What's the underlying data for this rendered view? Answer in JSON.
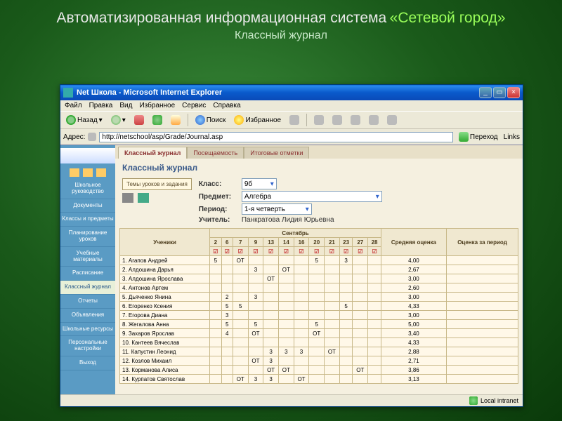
{
  "slide": {
    "title_plain": "Автоматизированная информационная система",
    "title_accent": "«Сетевой город»",
    "subtitle": "Классный журнал"
  },
  "window": {
    "title": "Net Школа - Microsoft Internet Explorer",
    "menus": [
      "Файл",
      "Правка",
      "Вид",
      "Избранное",
      "Сервис",
      "Справка"
    ],
    "toolbar": {
      "back": "Назад",
      "search": "Поиск",
      "favorites": "Избранное"
    },
    "address_label": "Адрес:",
    "address": "http://netschool/asp/Grade/Journal.asp",
    "go": "Переход",
    "links": "Links",
    "status": "Local intranet"
  },
  "sidebar": {
    "items": [
      "Школьное руководство",
      "Документы",
      "Классы и предметы",
      "Планирование уроков",
      "Учебные материалы",
      "Расписание",
      "Классный журнал",
      "Отчеты",
      "Объявления",
      "Школьные ресурсы",
      "Персональные настройки",
      "Выход"
    ]
  },
  "tabs": [
    "Классный журнал",
    "Посещаемость",
    "Итоговые отметки"
  ],
  "heading": "Классный журнал",
  "lesson_btn": "Темы уроков и задания",
  "filters": {
    "class_label": "Класс:",
    "class_value": "9б",
    "subject_label": "Предмет:",
    "subject_value": "Алгебра",
    "period_label": "Период:",
    "period_value": "1-я четверть",
    "teacher_label": "Учитель:",
    "teacher_value": "Панкратова Лидия Юрьевна"
  },
  "table": {
    "students_header": "Ученики",
    "month": "Сентябрь",
    "avg_header": "Средняя оценка",
    "period_header": "Оценка за период",
    "days": [
      "2",
      "6",
      "7",
      "9",
      "13",
      "14",
      "16",
      "20",
      "21",
      "23",
      "27",
      "28"
    ],
    "rows": [
      {
        "n": "1",
        "name": "Агапов Андрей",
        "cells": [
          "5",
          "",
          "ОТ",
          "",
          "",
          "",
          "",
          "5",
          "",
          "3",
          "",
          ""
        ],
        "avg": "4,00"
      },
      {
        "n": "2",
        "name": "Алдошина Дарья",
        "cells": [
          "",
          "",
          "",
          "3",
          "",
          "ОТ",
          "",
          "",
          "",
          "",
          "",
          ""
        ],
        "avg": "2,67"
      },
      {
        "n": "3",
        "name": "Алдошина Ярослава",
        "cells": [
          "",
          "",
          "",
          "",
          "ОТ",
          "",
          "",
          "",
          "",
          "",
          "",
          ""
        ],
        "avg": "3,00"
      },
      {
        "n": "4",
        "name": "Антонов Артем",
        "cells": [
          "",
          "",
          "",
          "",
          "",
          "",
          "",
          "",
          "",
          "",
          "",
          ""
        ],
        "avg": "2,60"
      },
      {
        "n": "5",
        "name": "Дьяченко Янина",
        "cells": [
          "",
          "2",
          "",
          "3",
          "",
          "",
          "",
          "",
          "",
          "",
          "",
          ""
        ],
        "avg": "3,00"
      },
      {
        "n": "6",
        "name": "Егоренко Ксения",
        "cells": [
          "",
          "5",
          "5",
          "",
          "",
          "",
          "",
          "",
          "",
          "5",
          "",
          ""
        ],
        "avg": "4,33"
      },
      {
        "n": "7",
        "name": "Егорова Диана",
        "cells": [
          "",
          "3",
          "",
          "",
          "",
          "",
          "",
          "",
          "",
          "",
          "",
          ""
        ],
        "avg": "3,00"
      },
      {
        "n": "8",
        "name": "Жегалова Анна",
        "cells": [
          "",
          "5",
          "",
          "5",
          "",
          "",
          "",
          "5",
          "",
          "",
          "",
          ""
        ],
        "avg": "5,00"
      },
      {
        "n": "9",
        "name": "Захаров Ярослав",
        "cells": [
          "",
          "4",
          "",
          "ОТ",
          "",
          "",
          "",
          "ОТ",
          "",
          "",
          "",
          ""
        ],
        "avg": "3,40"
      },
      {
        "n": "10",
        "name": "Кантеев Вячеслав",
        "cells": [
          "",
          "",
          "",
          "",
          "",
          "",
          "",
          "",
          "",
          "",
          "",
          ""
        ],
        "avg": "4,33"
      },
      {
        "n": "11",
        "name": "Капустин Леонид",
        "cells": [
          "",
          "",
          "",
          "",
          "3",
          "3",
          "3",
          "",
          "ОТ",
          "",
          "",
          ""
        ],
        "avg": "2,88"
      },
      {
        "n": "12",
        "name": "Козлов Михаил",
        "cells": [
          "",
          "",
          "",
          "ОТ",
          "3",
          "",
          "",
          "",
          "",
          "",
          "",
          ""
        ],
        "avg": "2,71"
      },
      {
        "n": "13",
        "name": "Корманова Алиса",
        "cells": [
          "",
          "",
          "",
          "",
          "ОТ",
          "ОТ",
          "",
          "",
          "",
          "",
          "ОТ",
          ""
        ],
        "avg": "3,86"
      },
      {
        "n": "14",
        "name": "Курпатов Святослав",
        "cells": [
          "",
          "",
          "ОТ",
          "3",
          "3",
          "",
          "ОТ",
          "",
          "",
          "",
          "",
          ""
        ],
        "avg": "3,13"
      }
    ]
  }
}
